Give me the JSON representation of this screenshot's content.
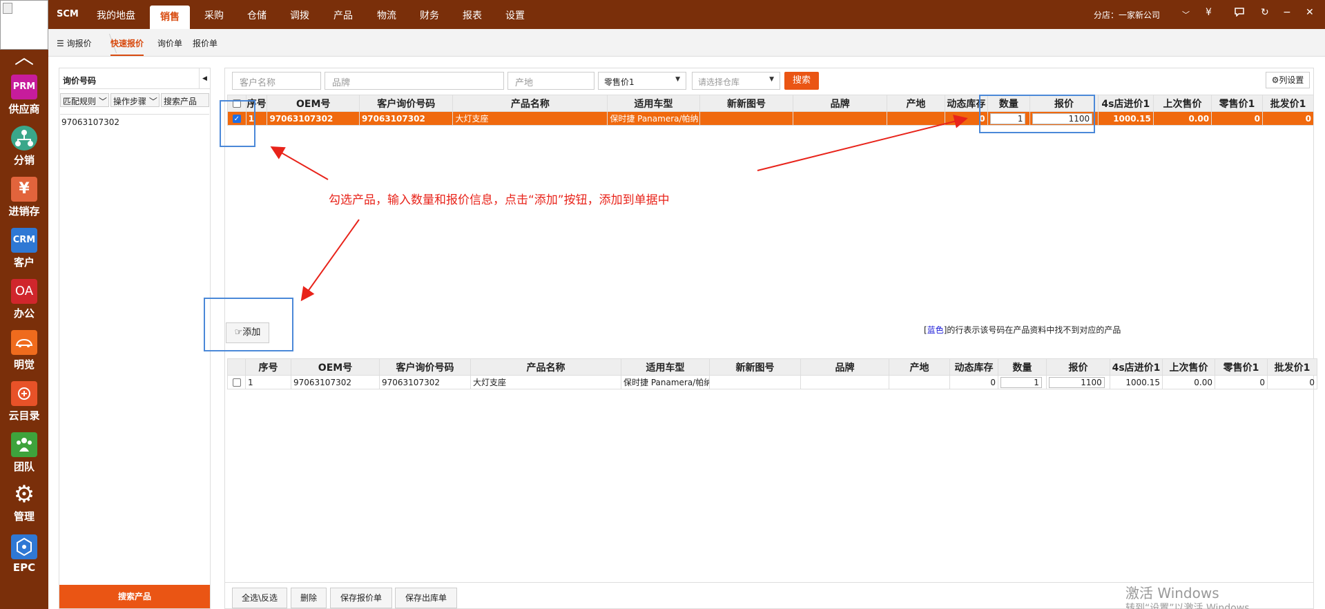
{
  "topbar": {
    "brand": "SCM",
    "nav": [
      "我的地盘",
      "销售",
      "采购",
      "仓储",
      "调拨",
      "产品",
      "物流",
      "财务",
      "报表",
      "设置"
    ],
    "branch": "分店：一家新公司",
    "currency": "¥",
    "icons": [
      "chevron-down-icon",
      "yen-icon",
      "chat-icon",
      "refresh-icon",
      "minimize-icon",
      "close-icon"
    ]
  },
  "sidebar": {
    "apps": [
      {
        "label": "供应商",
        "icon_text": "PRM",
        "color": "#c71c9c"
      },
      {
        "label": "分销",
        "icon_text": "",
        "color": "#3aa78a"
      },
      {
        "label": "进销存",
        "icon_text": "¥",
        "color": "#e2643c"
      },
      {
        "label": "客户",
        "icon_text": "CRM",
        "color": "#2f78d4"
      },
      {
        "label": "办公",
        "icon_text": "OA",
        "color": "#d0262c"
      },
      {
        "label": "明觉",
        "icon_text": "",
        "color": "#ef6b1d"
      },
      {
        "label": "云目录",
        "icon_text": "",
        "color": "#e85228"
      },
      {
        "label": "团队",
        "icon_text": "",
        "color": "#3ea33c"
      },
      {
        "label": "管理",
        "icon_text": "",
        "color": "#7a2f0a"
      },
      {
        "label": "EPC",
        "icon_text": "",
        "color": "#2f78d4"
      }
    ]
  },
  "subnav": {
    "items": [
      "询报价",
      "快速报价",
      "询价单",
      "报价单"
    ]
  },
  "left_panel": {
    "title": "询价号码",
    "buttons": [
      "匹配规则",
      "操作步骤",
      "搜索产品"
    ],
    "text": "97063107302",
    "search_button": "搜索产品"
  },
  "filters": {
    "customer_placeholder": "客户名称",
    "brand_placeholder": "品牌",
    "origin_placeholder": "产地",
    "price_select": "零售价1",
    "warehouse_placeholder": "请选择仓库",
    "search": "搜索",
    "column_settings": "列设置"
  },
  "table": {
    "headers": [
      "序号",
      "OEM号",
      "客户询价号码",
      "产品名称",
      "适用车型",
      "新新图号",
      "品牌",
      "产地",
      "动态库存",
      "数量",
      "报价",
      "4s店进价1",
      "上次售价",
      "零售价1",
      "批发价1"
    ],
    "top_rows": [
      {
        "index": "1",
        "oem": "97063107302",
        "inquiry_no": "97063107302",
        "name": "大灯支座",
        "model": "保时捷 Panamera/帕纳",
        "drawing": "",
        "brand": "",
        "origin": "",
        "stock": "0",
        "qty": "1",
        "quote": "1100",
        "cost_4s": "1000.15",
        "last_price": "0.00",
        "retail": "0",
        "wholesale": "0"
      }
    ],
    "bottom_rows": [
      {
        "index": "1",
        "oem": "97063107302",
        "inquiry_no": "97063107302",
        "name": "大灯支座",
        "model": "保时捷 Panamera/帕纳",
        "drawing": "",
        "brand": "",
        "origin": "",
        "stock": "0",
        "qty": "1",
        "quote": "1100",
        "cost_4s": "1000.15",
        "last_price": "0.00",
        "retail": "0",
        "wholesale": "0"
      }
    ]
  },
  "add_button": "添加",
  "legend": {
    "blue": "蓝色",
    "text": "的行表示该号码在产品资料中找不到对应的产品"
  },
  "bottom_buttons": [
    "全选\\反选",
    "删除",
    "保存报价单",
    "保存出库单"
  ],
  "annotation": "勾选产品，输入数量和报价信息，点击“添加”按钮，添加到单据中",
  "watermark": {
    "line1": "激活 Windows",
    "line2": "转到“设置”以激活 Windows"
  },
  "colors": {
    "accent": "#ea5514",
    "bar": "#7a2f0a",
    "annotation": "#e8231a",
    "highlight_box": "#4a88d8"
  }
}
